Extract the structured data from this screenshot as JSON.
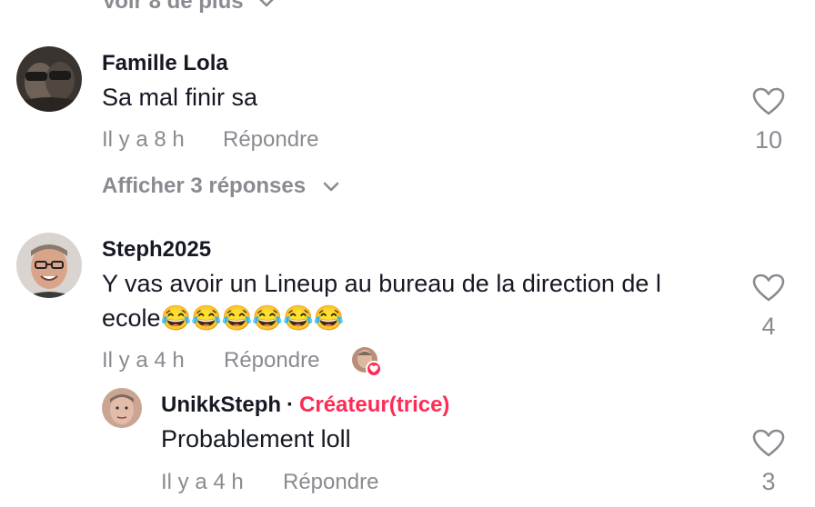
{
  "top_more": {
    "label": "Voir 8 de plus"
  },
  "comments": [
    {
      "author": "Famille Lola",
      "text": "Sa mal finir sa",
      "time": "Il y a 8 h",
      "reply_label": "Répondre",
      "likes": "10",
      "show_replies": "Afficher 3 réponses"
    },
    {
      "author": "Steph2025",
      "text_line1": "Y vas avoir un Lineup au bureau de la direction de l",
      "text_line2": "ecole😂😂😂😂😂😂",
      "time": "Il y a 4 h",
      "reply_label": "Répondre",
      "likes": "4"
    }
  ],
  "reply": {
    "author": "UnikkSteph",
    "separator": "·",
    "creator_label": "Créateur(trice)",
    "text": "Probablement loll",
    "time": "Il y a 4 h",
    "reply_label": "Répondre",
    "likes": "3"
  },
  "colors": {
    "accent": "#fe2c55",
    "muted": "#8a8b91",
    "text": "#161823"
  }
}
